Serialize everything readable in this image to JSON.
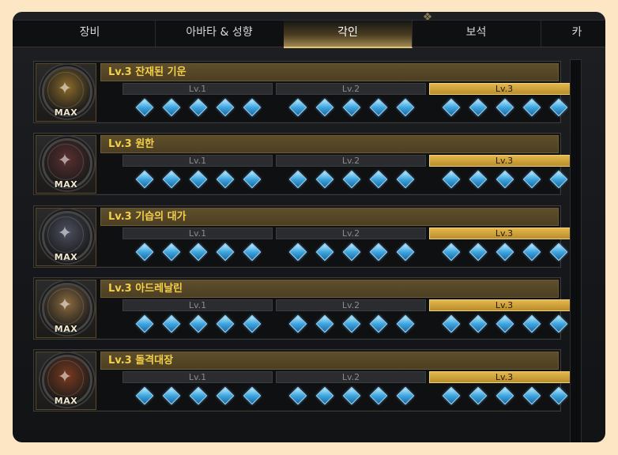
{
  "tabs": [
    {
      "label": "장비",
      "active": false
    },
    {
      "label": "아바타 & 성향",
      "active": false
    },
    {
      "label": "각인",
      "active": true
    },
    {
      "label": "보석",
      "active": false
    },
    {
      "label": "카",
      "active": false
    }
  ],
  "engravings": [
    {
      "title": "Lv.3 잔재된 기운",
      "badge": "MAX",
      "icon": "warrior-medal-icon",
      "medal_color": "#8a6a2a",
      "levels": [
        {
          "label": "Lv.1",
          "gems": 5,
          "active": false
        },
        {
          "label": "Lv.2",
          "gems": 5,
          "active": false
        },
        {
          "label": "Lv.3",
          "gems": 5,
          "active": true
        }
      ]
    },
    {
      "title": "Lv.3 원한",
      "badge": "MAX",
      "icon": "grudge-medal-icon",
      "medal_color": "#5a2f2f",
      "levels": [
        {
          "label": "Lv.1",
          "gems": 5,
          "active": false
        },
        {
          "label": "Lv.2",
          "gems": 5,
          "active": false
        },
        {
          "label": "Lv.3",
          "gems": 5,
          "active": true
        }
      ]
    },
    {
      "title": "Lv.3 기습의 대가",
      "badge": "MAX",
      "icon": "ambush-medal-icon",
      "medal_color": "#4c4f60",
      "levels": [
        {
          "label": "Lv.1",
          "gems": 5,
          "active": false
        },
        {
          "label": "Lv.2",
          "gems": 5,
          "active": false
        },
        {
          "label": "Lv.3",
          "gems": 5,
          "active": true
        }
      ]
    },
    {
      "title": "Lv.3 아드레날린",
      "badge": "MAX",
      "icon": "adrenaline-medal-icon",
      "medal_color": "#8a6a3f",
      "levels": [
        {
          "label": "Lv.1",
          "gems": 5,
          "active": false
        },
        {
          "label": "Lv.2",
          "gems": 5,
          "active": false
        },
        {
          "label": "Lv.3",
          "gems": 5,
          "active": true
        }
      ]
    },
    {
      "title": "Lv.3 돌격대장",
      "badge": "MAX",
      "icon": "raid-captain-medal-icon",
      "medal_color": "#7a3a1e",
      "levels": [
        {
          "label": "Lv.1",
          "gems": 5,
          "active": false
        },
        {
          "label": "Lv.2",
          "gems": 5,
          "active": false
        },
        {
          "label": "Lv.3",
          "gems": 5,
          "active": true
        }
      ]
    }
  ]
}
